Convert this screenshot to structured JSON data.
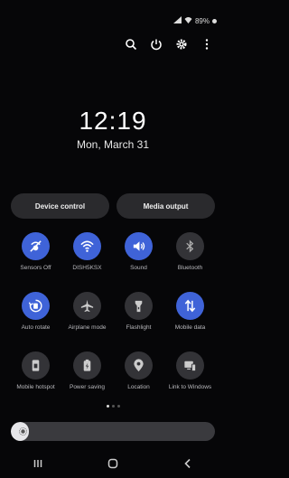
{
  "status_bar": {
    "battery": "89%"
  },
  "clock": {
    "time": "12:19",
    "date": "Mon, March 31"
  },
  "buttons": {
    "device_control": "Device control",
    "media_output": "Media output"
  },
  "tiles": [
    {
      "label": "Sensors Off",
      "on": true,
      "icon": "sensors-off-icon"
    },
    {
      "label": "DISH5KSX",
      "on": true,
      "icon": "wifi-icon"
    },
    {
      "label": "Sound",
      "on": true,
      "icon": "sound-icon"
    },
    {
      "label": "Bluetooth",
      "on": false,
      "icon": "bluetooth-icon"
    },
    {
      "label": "Auto rotate",
      "on": true,
      "icon": "auto-rotate-icon"
    },
    {
      "label": "Airplane mode",
      "on": false,
      "icon": "airplane-icon"
    },
    {
      "label": "Flashlight",
      "on": false,
      "icon": "flashlight-icon"
    },
    {
      "label": "Mobile data",
      "on": true,
      "icon": "mobile-data-icon"
    },
    {
      "label": "Mobile hotspot",
      "on": false,
      "icon": "hotspot-icon"
    },
    {
      "label": "Power saving",
      "on": false,
      "icon": "power-saving-icon"
    },
    {
      "label": "Location",
      "on": false,
      "icon": "location-icon"
    },
    {
      "label": "Link to Windows",
      "on": false,
      "icon": "link-to-windows-icon"
    }
  ],
  "pager": {
    "pages": 3,
    "active": 0
  },
  "brightness": {
    "level": 0.02
  },
  "colors": {
    "accent": "#3f63d8",
    "tile_off": "#333337",
    "background": "#060608"
  }
}
